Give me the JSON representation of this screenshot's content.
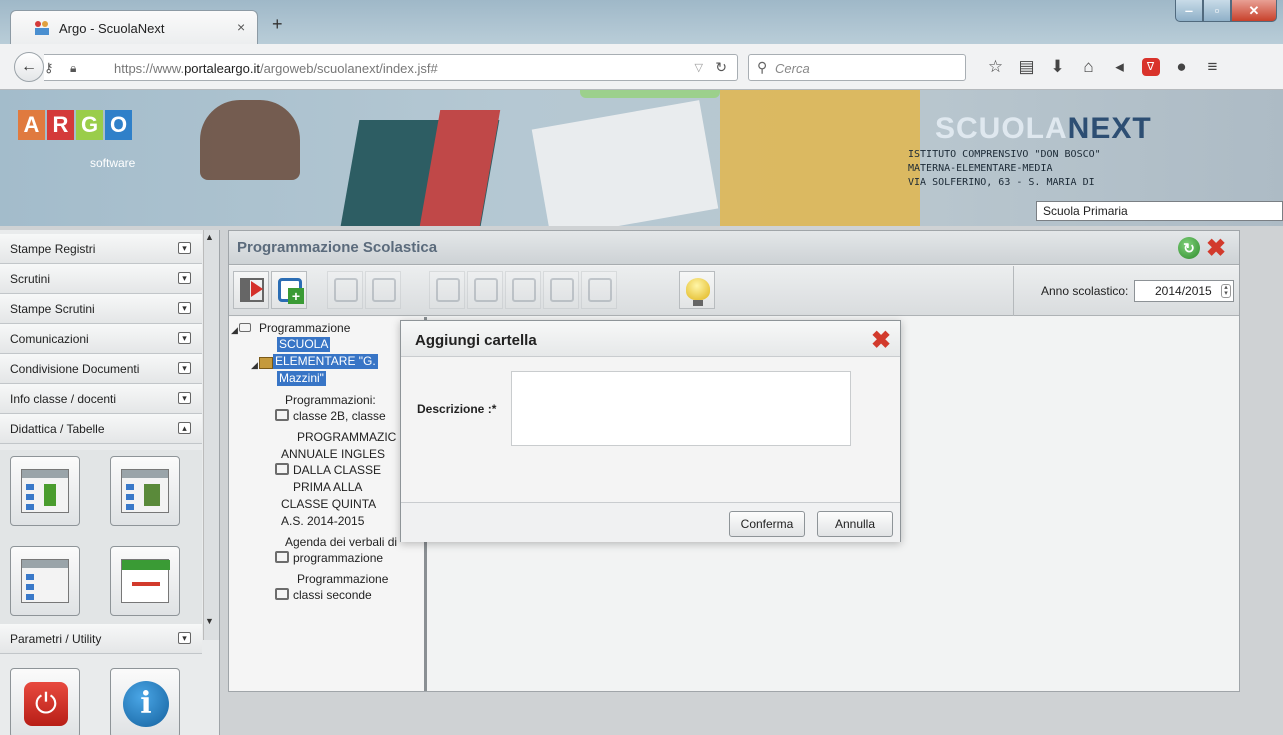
{
  "browser": {
    "tab_title": "Argo - ScuolaNext",
    "tab_close": "×",
    "new_tab": "+",
    "url_prefix": "https://www.",
    "url_domain": "portaleargo.it",
    "url_path": "/argoweb/scuolanext/index.jsf#",
    "search_placeholder": "Cerca"
  },
  "banner": {
    "logo_letters": [
      "A",
      "R",
      "G",
      "O"
    ],
    "logo_colors": [
      "#e07a3f",
      "#d43a3a",
      "#9acd4a",
      "#2f80c9"
    ],
    "logo_sub": "software",
    "brand_a": "SCUOLA",
    "brand_b": "NEXT",
    "school_line1": "ISTITUTO COMPRENSIVO \"DON BOSCO\"",
    "school_line2": "MATERNA-ELEMENTARE-MEDIA",
    "school_line3": "VIA SOLFERINO, 63 - S. MARIA DI",
    "school_selected": "Scuola Primaria"
  },
  "sidebar": {
    "items": [
      {
        "label": "Stampe Registri"
      },
      {
        "label": "Scrutini"
      },
      {
        "label": "Stampe Scrutini"
      },
      {
        "label": "Comunicazioni"
      },
      {
        "label": "Condivisione Documenti"
      },
      {
        "label": "Info classe / docenti"
      },
      {
        "label": "Didattica / Tabelle"
      }
    ],
    "bottom_item": "Parametri / Utility"
  },
  "main": {
    "title": "Programmazione Scolastica",
    "anno_label": "Anno scolastico:",
    "anno_value": "2014/2015"
  },
  "tree": {
    "root": "Programmazione",
    "school_1": "SCUOLA",
    "school_2": "ELEMENTARE \"G.",
    "school_3": "Mazzini\"",
    "f1_1": "Programmazioni:",
    "f1_2": "classe 2B, classe",
    "f2_1": "PROGRAMMAZIC",
    "f2_2": "ANNUALE INGLES",
    "f2_3": "DALLA CLASSE",
    "f2_4": "PRIMA ALLA",
    "f2_5": "CLASSE QUINTA",
    "f2_6": "A.S. 2014-2015",
    "f3_1": "Agenda dei verbali di",
    "f3_2": "programmazione",
    "f4_1": "Programmazione",
    "f4_2": "classi seconde"
  },
  "modal": {
    "title": "Aggiungi cartella",
    "desc_label": "Descrizione :*",
    "desc_value": "",
    "confirm": "Conferma",
    "cancel": "Annulla"
  }
}
